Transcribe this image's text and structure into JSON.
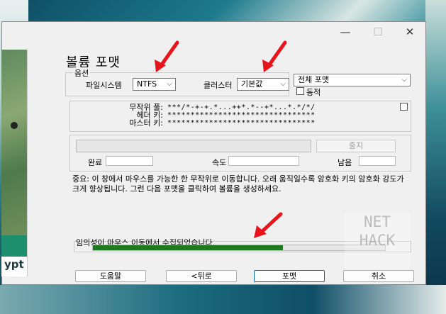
{
  "window": {
    "title": "볼륨 포맷",
    "minimize_glyph": "—",
    "maximize_glyph": "☐",
    "close_glyph": "✕"
  },
  "options": {
    "group_label": "옵션",
    "filesystem_label": "파일시스템",
    "filesystem_value": "NTFS",
    "cluster_label": "클러스터",
    "cluster_value": "기본값",
    "format_mode_value": "전체 포맷",
    "dynamic_label": "동적"
  },
  "keys": {
    "random_pool_label": "무작위 풀:",
    "random_pool_value": "***/*-+-+.*...++*.*--+*...*.*/*/",
    "header_key_label": "헤더 키:",
    "header_key_value": "********************************",
    "master_key_label": "마스터 키:",
    "master_key_value": "********************************"
  },
  "progress": {
    "stop_label": "중지",
    "done_label": "완료",
    "speed_label": "속도",
    "remaining_label": "남음"
  },
  "info_text": "중요: 이 창에서 마우스를 가능한 한 무작위로 이동합니다. 오래 움직일수록 암호화 키의 암호화 강도가 크게 향상됩니다. 그런 다음 포맷을 클릭하여 볼륨을 생성하세요.",
  "randomness": {
    "label": "임의성이 마우스 이동에서 수집되었습니다.",
    "fill_fraction": 0.65
  },
  "buttons": {
    "help": "도움말",
    "back": "<뒤로",
    "format": "포맷",
    "cancel": "취소"
  },
  "background_app": {
    "fragment_text": "ypt"
  },
  "watermark": {
    "text": "NET HACK"
  },
  "colors": {
    "progress_fill": "#1f7a1f",
    "arrow": "#e8141b",
    "accent_border": "#0067c0"
  }
}
